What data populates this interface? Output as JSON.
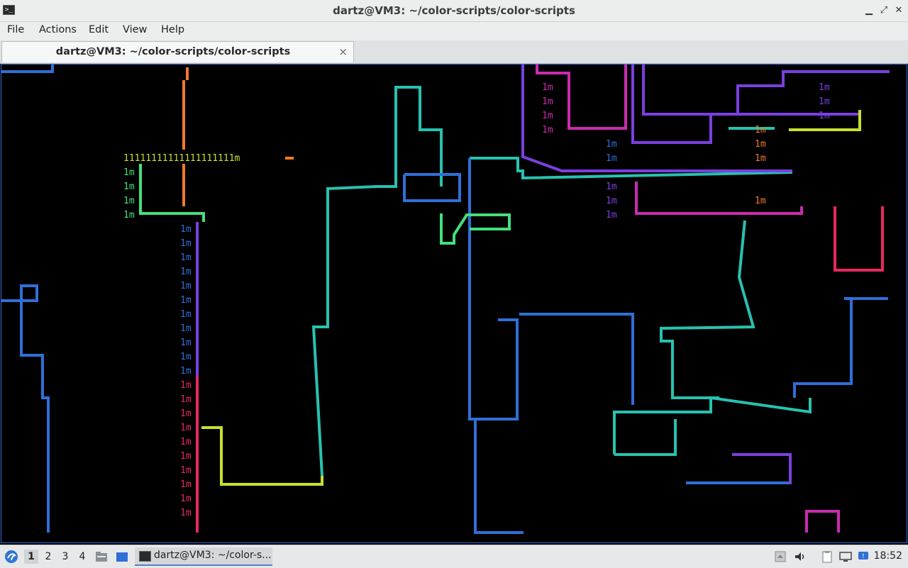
{
  "window": {
    "app_icon": "terminal-icon",
    "title": "dartz@VM3: ~/color-scripts/color-scripts",
    "controls": [
      "minimize-icon",
      "maximize-icon",
      "close-icon"
    ]
  },
  "menu": {
    "items": [
      "File",
      "Actions",
      "Edit",
      "View",
      "Help"
    ]
  },
  "tabs": [
    {
      "label": "dartz@VM3: ~/color-scripts/color-scripts",
      "close_glyph": "×"
    }
  ],
  "terminal": {
    "background": "#000000",
    "text_top_row": "11111111111111111111m",
    "glyph": "1m"
  },
  "taskbar": {
    "start_icon": "lxqt-start-icon",
    "workspaces": [
      "1",
      "2",
      "3",
      "4"
    ],
    "active_workspace": "1",
    "quicklaunch": [
      "file-manager-icon",
      "show-desktop-icon"
    ],
    "task_label": "dartz@VM3: ~/color-s...",
    "tray": [
      "update-icon",
      "volume-icon",
      "clipboard-icon",
      "network-icon",
      "notification-icon"
    ],
    "clock": "18:52"
  },
  "colors": {
    "accent": "#3b6dd6",
    "blue": "#2f6fd8",
    "teal": "#27c2b0",
    "green": "#43e07a",
    "purple": "#7b3fe0",
    "magenta": "#c92bb0",
    "red": "#e8285f",
    "orange": "#f07a2a",
    "yellow": "#c9e02a"
  }
}
